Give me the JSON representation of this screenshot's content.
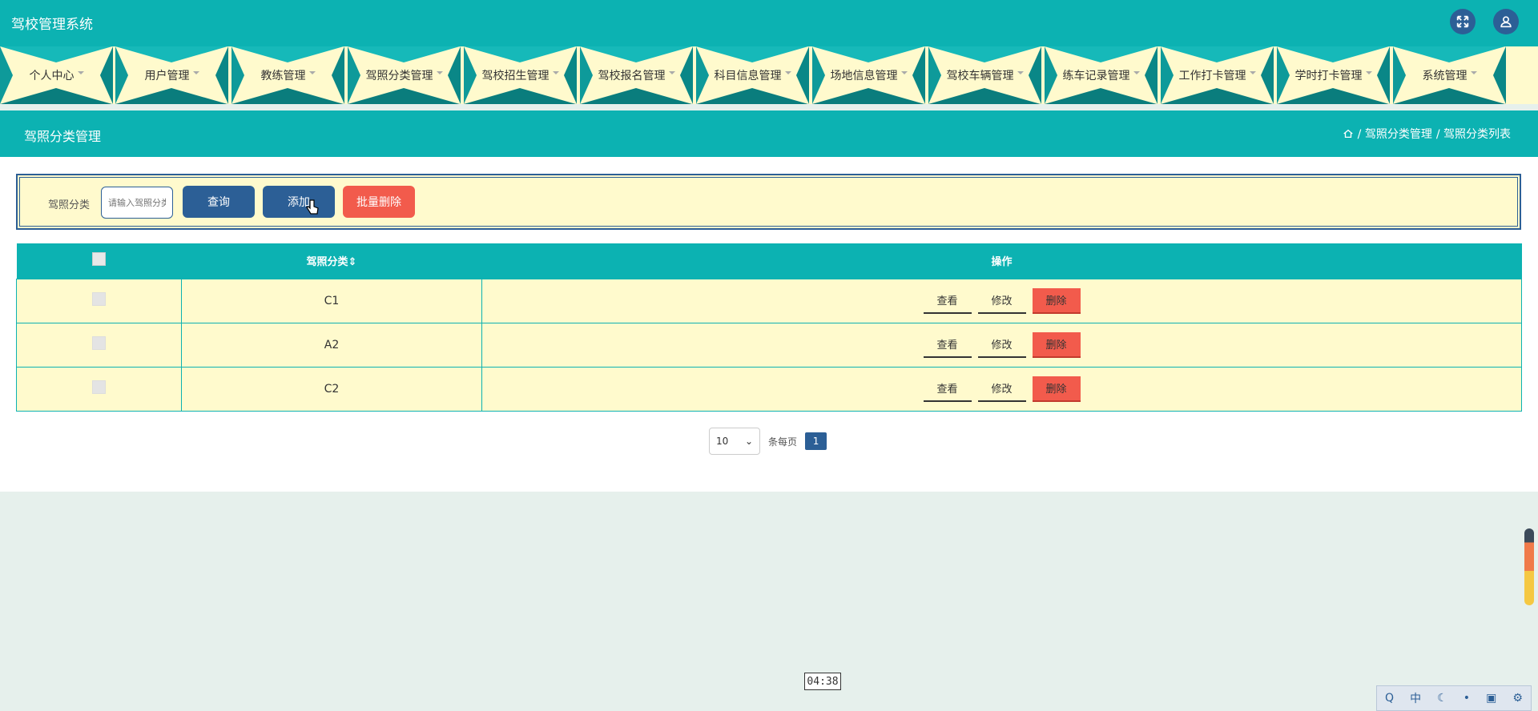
{
  "app": {
    "title": "驾校管理系统"
  },
  "nav": [
    {
      "label": "个人中心"
    },
    {
      "label": "用户管理"
    },
    {
      "label": "教练管理"
    },
    {
      "label": "驾照分类管理"
    },
    {
      "label": "驾校招生管理"
    },
    {
      "label": "驾校报名管理"
    },
    {
      "label": "科目信息管理"
    },
    {
      "label": "场地信息管理"
    },
    {
      "label": "驾校车辆管理"
    },
    {
      "label": "练车记录管理"
    },
    {
      "label": "工作打卡管理"
    },
    {
      "label": "学时打卡管理"
    },
    {
      "label": "系统管理"
    }
  ],
  "page": {
    "title": "驾照分类管理",
    "breadcrumb": [
      "/ 驾照分类管理",
      "/ 驾照分类列表"
    ]
  },
  "search": {
    "label": "驾照分类",
    "placeholder": "请输入驾照分类",
    "query_label": "查询",
    "add_label": "添加",
    "batch_delete_label": "批量删除"
  },
  "table": {
    "headers": {
      "category": "驾照分类",
      "sort_glyph": "⇕",
      "actions": "操作"
    },
    "rows": [
      {
        "category": "C1"
      },
      {
        "category": "A2"
      },
      {
        "category": "C2"
      }
    ],
    "actions": {
      "view": "查看",
      "edit": "修改",
      "delete": "删除"
    }
  },
  "pagination": {
    "page_size": "10",
    "per_page_label": "条每页",
    "current_page": "1"
  },
  "overlay": {
    "timer": "04:38"
  },
  "colors": {
    "teal": "#0cb2b2",
    "cream": "#fffacd",
    "navy": "#2c5f96",
    "red": "#f25b4c"
  }
}
